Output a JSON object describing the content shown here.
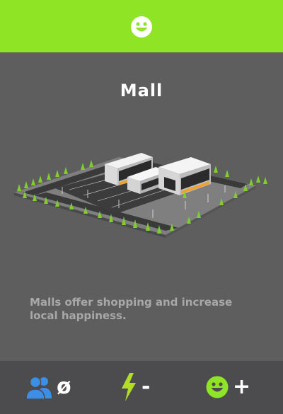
{
  "header": {
    "icon": "smiley-face-icon",
    "color": "#8ee425"
  },
  "building": {
    "name": "Mall",
    "image": "mall-3d-illustration",
    "description": "Malls offer shopping and increase local happiness."
  },
  "stats": {
    "population": {
      "icon": "people-icon",
      "value": "ø",
      "color": "#3d8ee8"
    },
    "power": {
      "icon": "lightning-bolt-icon",
      "value": "-",
      "color": "#b2dc28"
    },
    "happiness": {
      "icon": "smiley-face-icon",
      "value": "+",
      "color": "#8ee425"
    }
  }
}
